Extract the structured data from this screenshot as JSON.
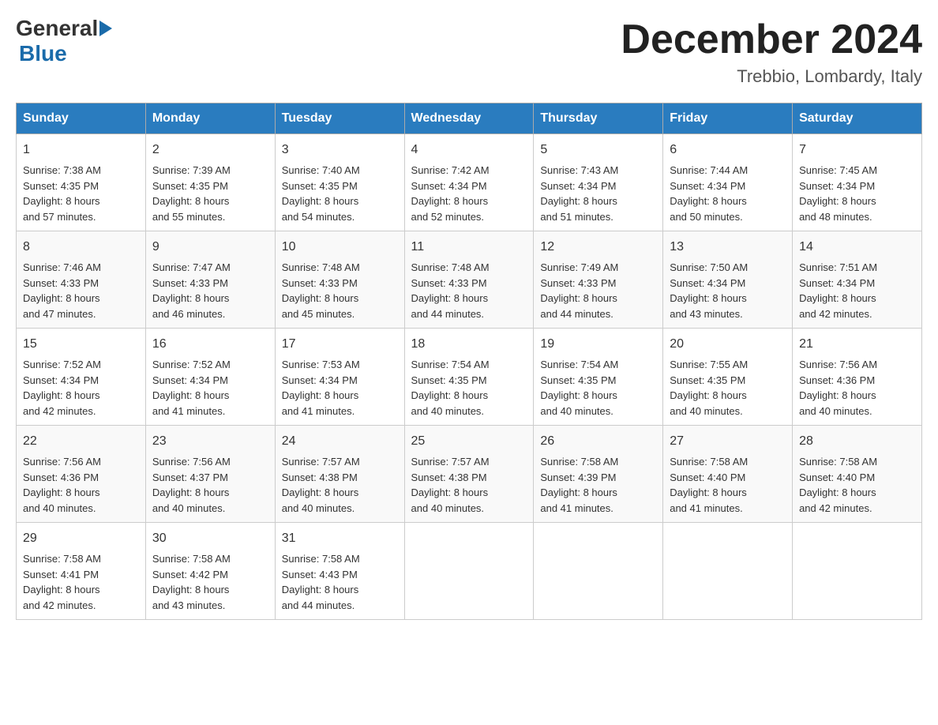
{
  "header": {
    "logo_general": "General",
    "logo_blue": "Blue",
    "month_year": "December 2024",
    "location": "Trebbio, Lombardy, Italy"
  },
  "days_of_week": [
    "Sunday",
    "Monday",
    "Tuesday",
    "Wednesday",
    "Thursday",
    "Friday",
    "Saturday"
  ],
  "weeks": [
    [
      {
        "day": "1",
        "sunrise": "7:38 AM",
        "sunset": "4:35 PM",
        "daylight": "8 hours and 57 minutes."
      },
      {
        "day": "2",
        "sunrise": "7:39 AM",
        "sunset": "4:35 PM",
        "daylight": "8 hours and 55 minutes."
      },
      {
        "day": "3",
        "sunrise": "7:40 AM",
        "sunset": "4:35 PM",
        "daylight": "8 hours and 54 minutes."
      },
      {
        "day": "4",
        "sunrise": "7:42 AM",
        "sunset": "4:34 PM",
        "daylight": "8 hours and 52 minutes."
      },
      {
        "day": "5",
        "sunrise": "7:43 AM",
        "sunset": "4:34 PM",
        "daylight": "8 hours and 51 minutes."
      },
      {
        "day": "6",
        "sunrise": "7:44 AM",
        "sunset": "4:34 PM",
        "daylight": "8 hours and 50 minutes."
      },
      {
        "day": "7",
        "sunrise": "7:45 AM",
        "sunset": "4:34 PM",
        "daylight": "8 hours and 48 minutes."
      }
    ],
    [
      {
        "day": "8",
        "sunrise": "7:46 AM",
        "sunset": "4:33 PM",
        "daylight": "8 hours and 47 minutes."
      },
      {
        "day": "9",
        "sunrise": "7:47 AM",
        "sunset": "4:33 PM",
        "daylight": "8 hours and 46 minutes."
      },
      {
        "day": "10",
        "sunrise": "7:48 AM",
        "sunset": "4:33 PM",
        "daylight": "8 hours and 45 minutes."
      },
      {
        "day": "11",
        "sunrise": "7:48 AM",
        "sunset": "4:33 PM",
        "daylight": "8 hours and 44 minutes."
      },
      {
        "day": "12",
        "sunrise": "7:49 AM",
        "sunset": "4:33 PM",
        "daylight": "8 hours and 44 minutes."
      },
      {
        "day": "13",
        "sunrise": "7:50 AM",
        "sunset": "4:34 PM",
        "daylight": "8 hours and 43 minutes."
      },
      {
        "day": "14",
        "sunrise": "7:51 AM",
        "sunset": "4:34 PM",
        "daylight": "8 hours and 42 minutes."
      }
    ],
    [
      {
        "day": "15",
        "sunrise": "7:52 AM",
        "sunset": "4:34 PM",
        "daylight": "8 hours and 42 minutes."
      },
      {
        "day": "16",
        "sunrise": "7:52 AM",
        "sunset": "4:34 PM",
        "daylight": "8 hours and 41 minutes."
      },
      {
        "day": "17",
        "sunrise": "7:53 AM",
        "sunset": "4:34 PM",
        "daylight": "8 hours and 41 minutes."
      },
      {
        "day": "18",
        "sunrise": "7:54 AM",
        "sunset": "4:35 PM",
        "daylight": "8 hours and 40 minutes."
      },
      {
        "day": "19",
        "sunrise": "7:54 AM",
        "sunset": "4:35 PM",
        "daylight": "8 hours and 40 minutes."
      },
      {
        "day": "20",
        "sunrise": "7:55 AM",
        "sunset": "4:35 PM",
        "daylight": "8 hours and 40 minutes."
      },
      {
        "day": "21",
        "sunrise": "7:56 AM",
        "sunset": "4:36 PM",
        "daylight": "8 hours and 40 minutes."
      }
    ],
    [
      {
        "day": "22",
        "sunrise": "7:56 AM",
        "sunset": "4:36 PM",
        "daylight": "8 hours and 40 minutes."
      },
      {
        "day": "23",
        "sunrise": "7:56 AM",
        "sunset": "4:37 PM",
        "daylight": "8 hours and 40 minutes."
      },
      {
        "day": "24",
        "sunrise": "7:57 AM",
        "sunset": "4:38 PM",
        "daylight": "8 hours and 40 minutes."
      },
      {
        "day": "25",
        "sunrise": "7:57 AM",
        "sunset": "4:38 PM",
        "daylight": "8 hours and 40 minutes."
      },
      {
        "day": "26",
        "sunrise": "7:58 AM",
        "sunset": "4:39 PM",
        "daylight": "8 hours and 41 minutes."
      },
      {
        "day": "27",
        "sunrise": "7:58 AM",
        "sunset": "4:40 PM",
        "daylight": "8 hours and 41 minutes."
      },
      {
        "day": "28",
        "sunrise": "7:58 AM",
        "sunset": "4:40 PM",
        "daylight": "8 hours and 42 minutes."
      }
    ],
    [
      {
        "day": "29",
        "sunrise": "7:58 AM",
        "sunset": "4:41 PM",
        "daylight": "8 hours and 42 minutes."
      },
      {
        "day": "30",
        "sunrise": "7:58 AM",
        "sunset": "4:42 PM",
        "daylight": "8 hours and 43 minutes."
      },
      {
        "day": "31",
        "sunrise": "7:58 AM",
        "sunset": "4:43 PM",
        "daylight": "8 hours and 44 minutes."
      },
      null,
      null,
      null,
      null
    ]
  ],
  "labels": {
    "sunrise": "Sunrise:",
    "sunset": "Sunset:",
    "daylight": "Daylight:"
  }
}
